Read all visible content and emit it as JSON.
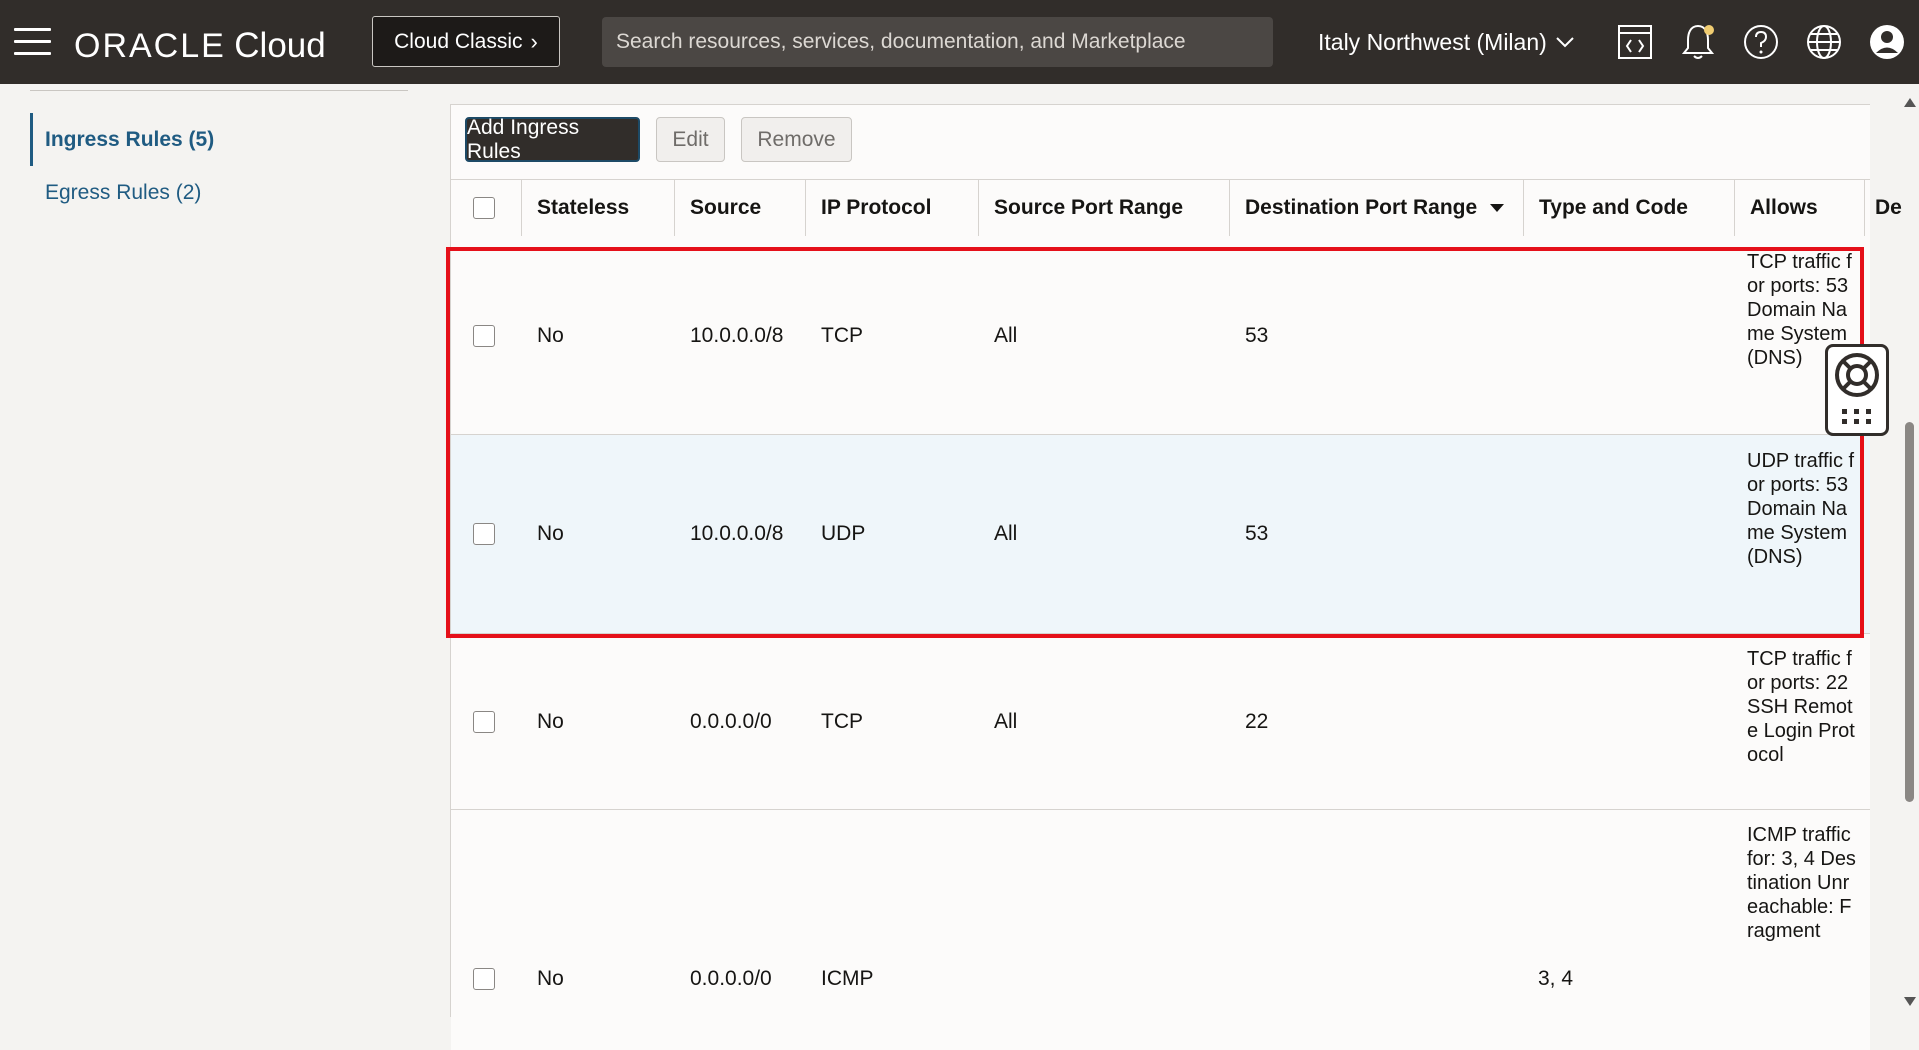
{
  "header": {
    "brand_main": "ORACLE",
    "brand_sub": "Cloud",
    "classic_button": "Cloud Classic",
    "search_placeholder": "Search resources, services, documentation, and Marketplace",
    "region": "Italy Northwest (Milan)"
  },
  "sidebar": {
    "items": [
      {
        "label": "Ingress Rules (5)",
        "active": true
      },
      {
        "label": "Egress Rules (2)",
        "active": false
      }
    ]
  },
  "toolbar": {
    "add_label": "Add Ingress Rules",
    "edit_label": "Edit",
    "remove_label": "Remove"
  },
  "table": {
    "columns": [
      "Stateless",
      "Source",
      "IP Protocol",
      "Source Port Range",
      "Destination Port Range",
      "Type and Code",
      "Allows",
      "De"
    ],
    "rows": [
      {
        "stateless": "No",
        "source": "10.0.0.0/8",
        "protocol": "TCP",
        "src_port": "All",
        "dst_port": "53",
        "type_code": "",
        "allows": "TCP traffic for ports: 53 Domain Name System (DNS)"
      },
      {
        "stateless": "No",
        "source": "10.0.0.0/8",
        "protocol": "UDP",
        "src_port": "All",
        "dst_port": "53",
        "type_code": "",
        "allows": "UDP traffic for ports: 53 Domain Name System (DNS)"
      },
      {
        "stateless": "No",
        "source": "0.0.0.0/0",
        "protocol": "TCP",
        "src_port": "All",
        "dst_port": "22",
        "type_code": "",
        "allows": "TCP traffic for ports: 22 SSH Remote Login Protocol"
      },
      {
        "stateless": "No",
        "source": "0.0.0.0/0",
        "protocol": "ICMP",
        "src_port": "",
        "dst_port": "",
        "type_code": "3, 4",
        "allows": "ICMP traffic for: 3, 4 Destination Unreachable: Fragment"
      }
    ]
  },
  "colors": {
    "header_bg": "#312d2a",
    "link": "#1f5b82",
    "highlight": "#e5101a"
  }
}
